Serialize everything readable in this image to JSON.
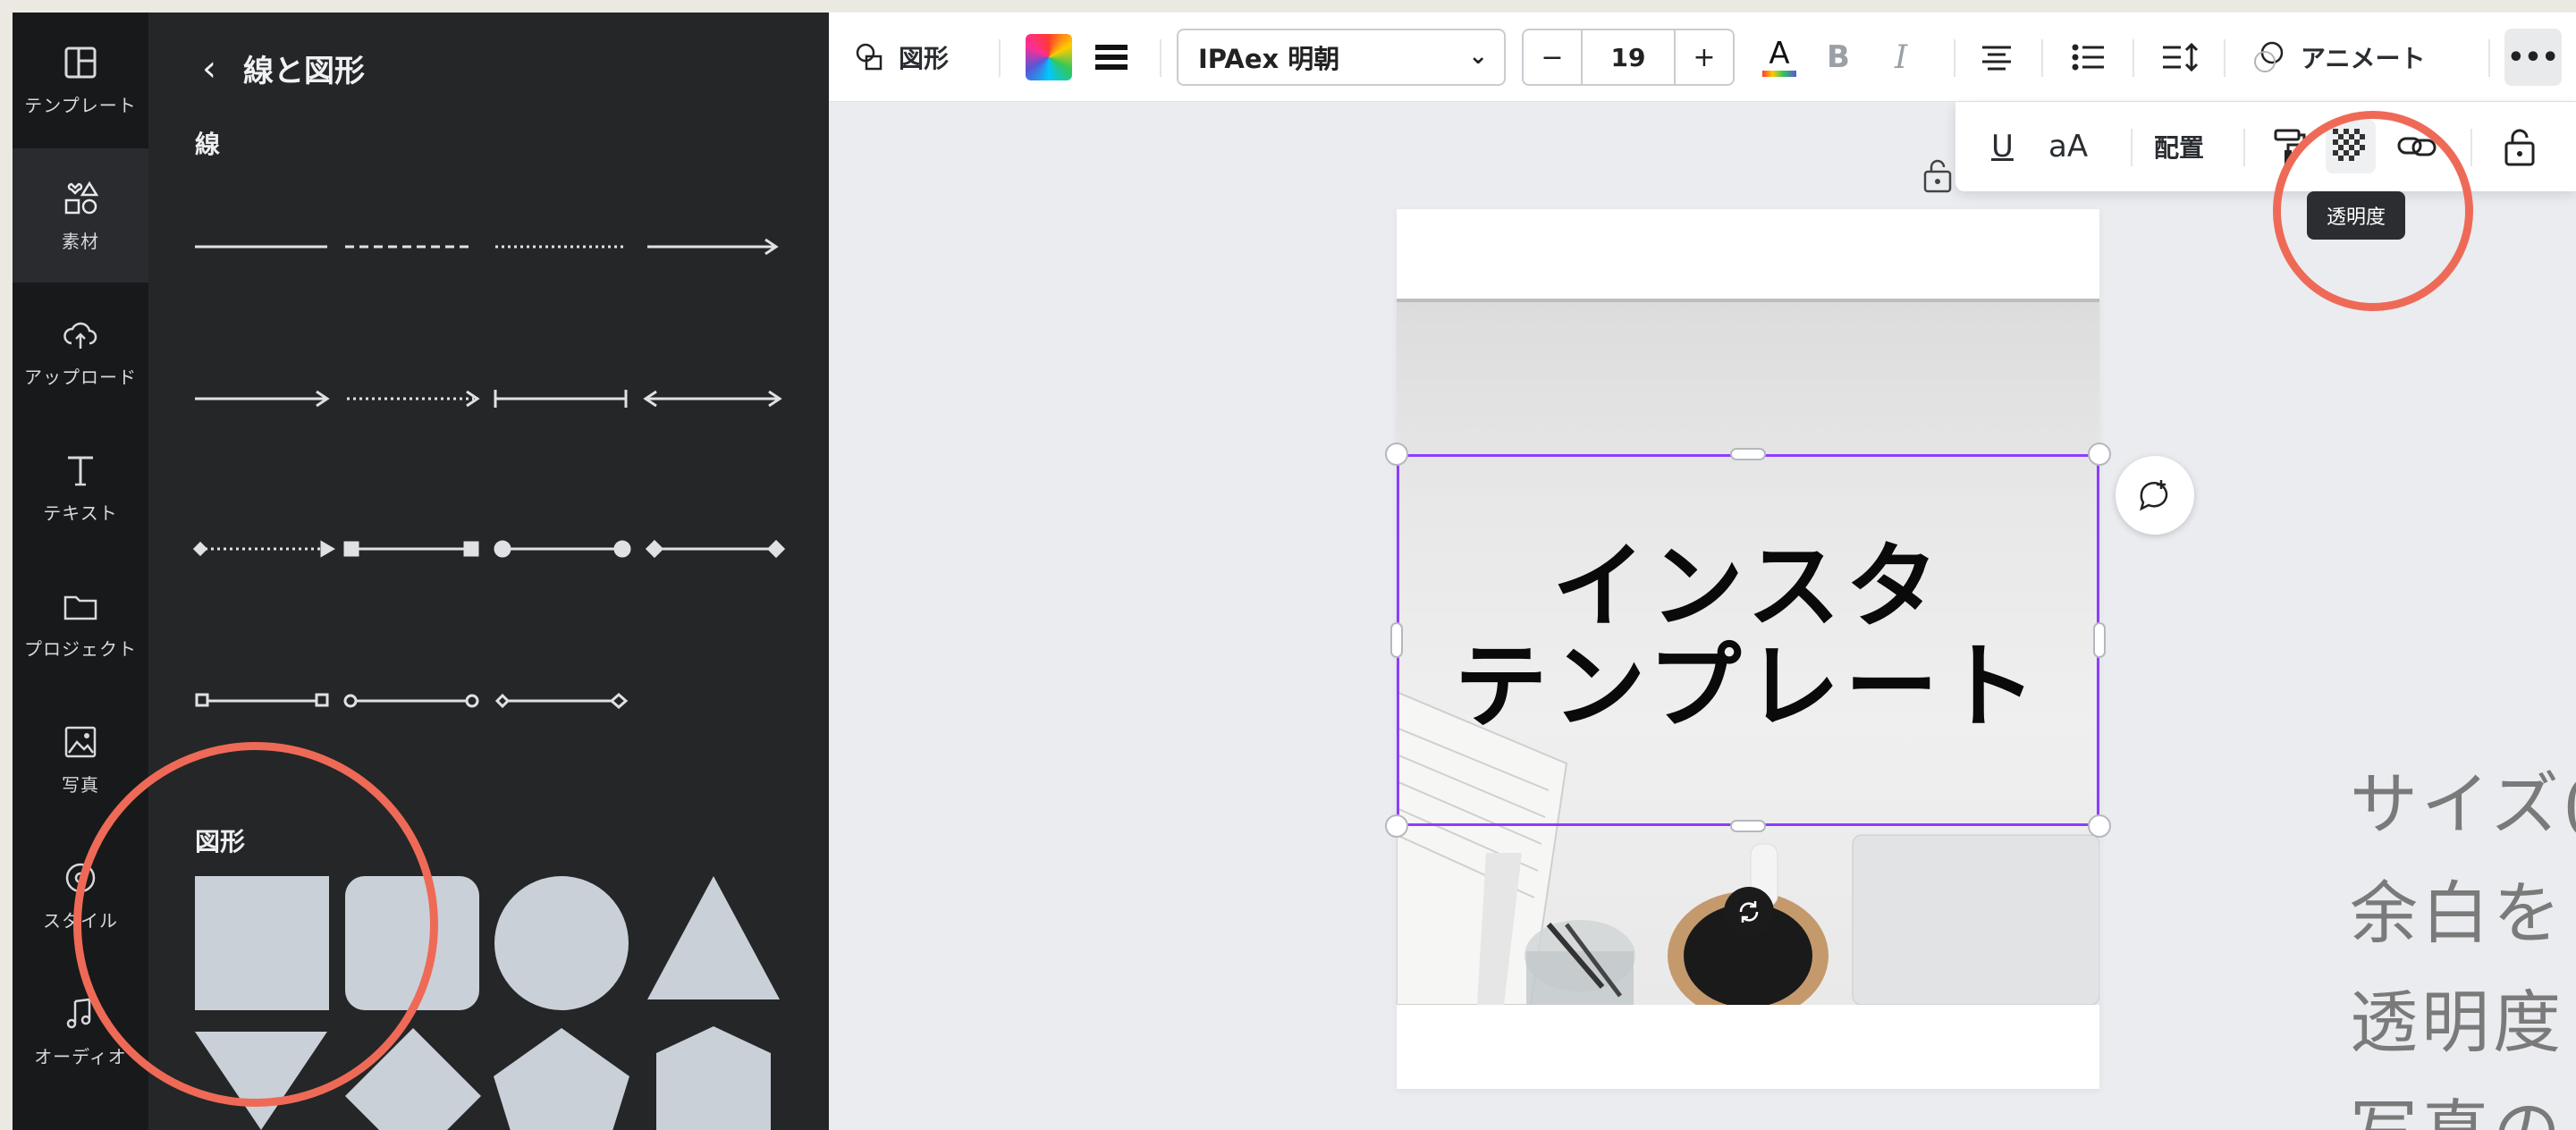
{
  "rail": {
    "items": [
      {
        "label": "テンプレート",
        "icon": "layout-icon"
      },
      {
        "label": "素材",
        "icon": "elements-icon"
      },
      {
        "label": "アップロード",
        "icon": "cloud-upload-icon"
      },
      {
        "label": "テキスト",
        "icon": "text-icon"
      },
      {
        "label": "プロジェクト",
        "icon": "folder-icon"
      },
      {
        "label": "写真",
        "icon": "photo-icon"
      },
      {
        "label": "スタイル",
        "icon": "palette-icon"
      },
      {
        "label": "オーディオ",
        "icon": "music-icon"
      }
    ],
    "active_index": 1
  },
  "panel": {
    "header": "線と図形",
    "lines_label": "線",
    "shapes_label": "図形"
  },
  "toolbar": {
    "shape_label": "図形",
    "font_name": "IPAex 明朝",
    "font_size": "19",
    "minus": "−",
    "plus": "+",
    "bold": "B",
    "italic": "I",
    "animate_label": "アニメート",
    "more": "•••"
  },
  "subbar": {
    "underline": "U",
    "case": "aA",
    "position_label": "配置"
  },
  "tooltip": {
    "text": "透明度"
  },
  "design": {
    "title_line1": "インスタ",
    "title_line2": "テンプレート"
  },
  "overlay_lines": [
    "サイズ(",
    "余白を",
    "透明度",
    "写真の"
  ],
  "colors": {
    "accent_purple": "#8b3dff",
    "annotation_red": "#ee6a57",
    "panel_bg": "#252627",
    "rail_bg": "#18191b"
  }
}
